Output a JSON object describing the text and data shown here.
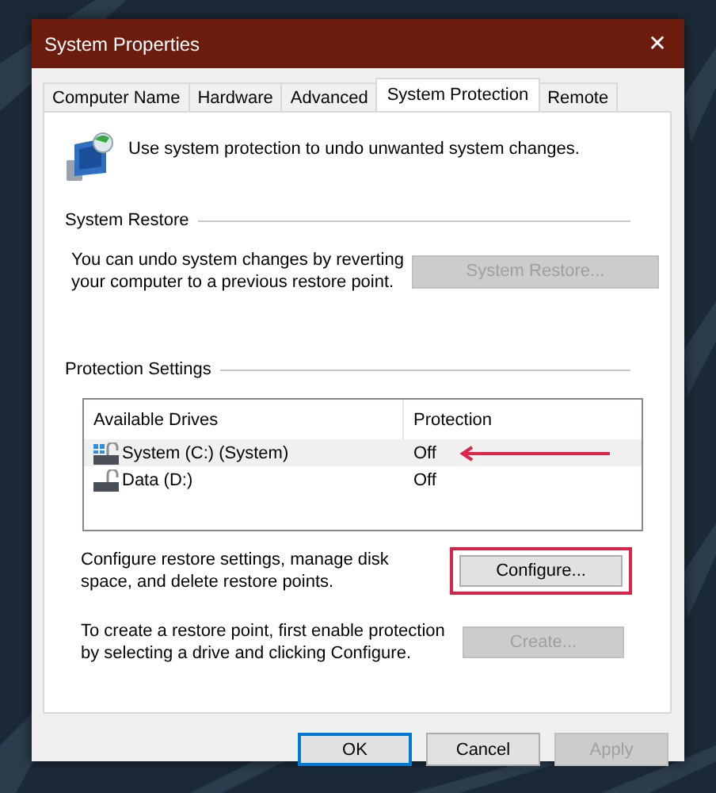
{
  "window": {
    "title": "System Properties",
    "close": "✕"
  },
  "tabs": [
    {
      "label": "Computer Name",
      "selected": false
    },
    {
      "label": "Hardware",
      "selected": false
    },
    {
      "label": "Advanced",
      "selected": false
    },
    {
      "label": "System Protection",
      "selected": true
    },
    {
      "label": "Remote",
      "selected": false
    }
  ],
  "intro": "Use system protection to undo unwanted system changes.",
  "system_restore": {
    "heading": "System Restore",
    "text": "You can undo system changes by reverting your computer to a previous restore point.",
    "button": {
      "label": "System Restore...",
      "disabled": true
    }
  },
  "protection_settings": {
    "heading": "Protection Settings",
    "columns": [
      "Available Drives",
      "Protection"
    ],
    "rows": [
      {
        "drive": "System (C:) (System)",
        "protection": "Off",
        "kind": "system",
        "selected": true,
        "arrow": true
      },
      {
        "drive": "Data (D:)",
        "protection": "Off",
        "kind": "data",
        "selected": false,
        "arrow": false
      }
    ],
    "configure": {
      "text": "Configure restore settings, manage disk space, and delete restore points.",
      "button": {
        "label": "Configure...",
        "disabled": false,
        "highlighted": true
      }
    },
    "create": {
      "text": "To create a restore point, first enable protection by selecting a drive and clicking Configure.",
      "button": {
        "label": "Create...",
        "disabled": true
      }
    }
  },
  "buttons": [
    {
      "label": "OK",
      "disabled": false,
      "default": true
    },
    {
      "label": "Cancel",
      "disabled": false,
      "default": false
    },
    {
      "label": "Apply",
      "disabled": true,
      "default": false
    }
  ]
}
